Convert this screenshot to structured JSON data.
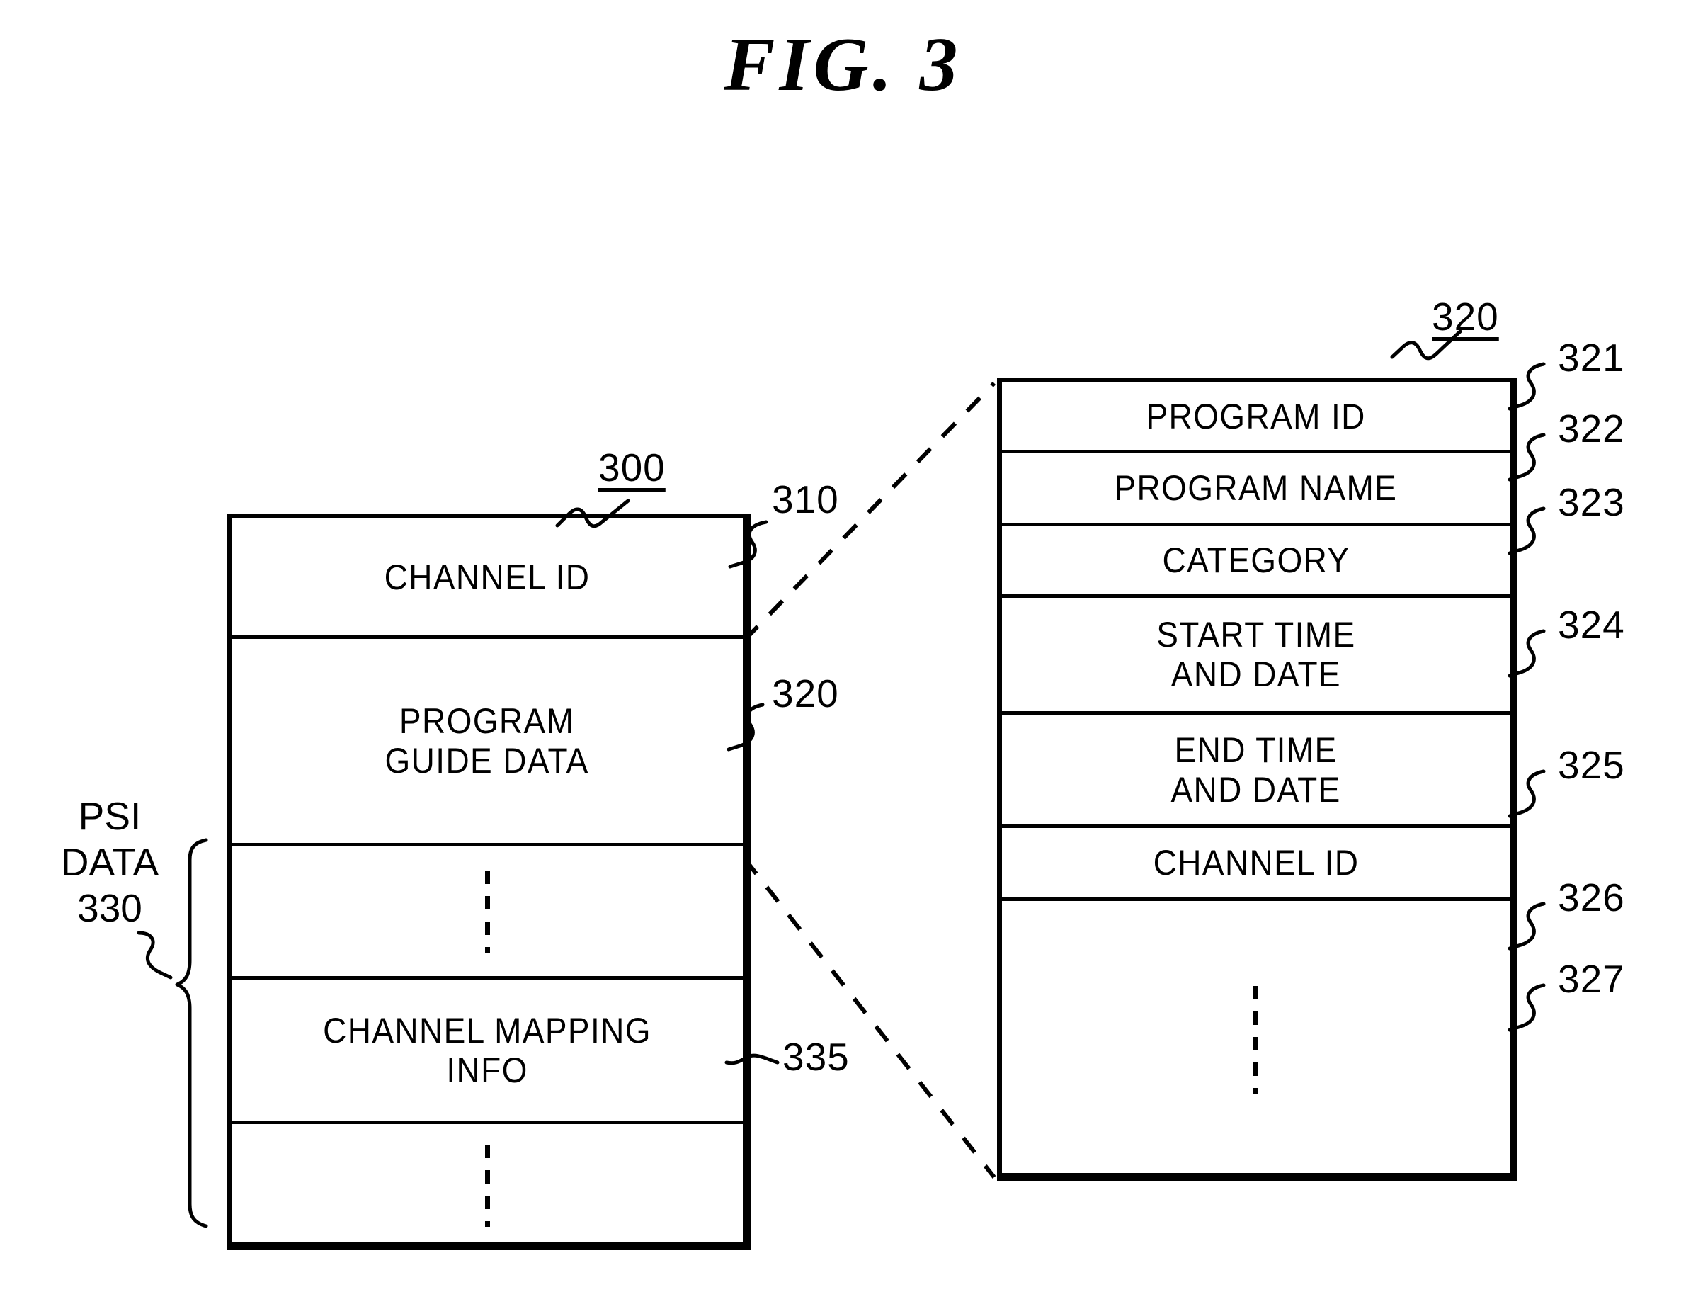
{
  "figure": {
    "title": "FIG.  3"
  },
  "left_structure": {
    "ref": "300",
    "rows": [
      {
        "label": "CHANNEL ID",
        "ref": "310",
        "kind": "text"
      },
      {
        "label": "PROGRAM\nGUIDE DATA",
        "ref": "320",
        "kind": "text"
      },
      {
        "label": "",
        "ref": "",
        "kind": "ellipsis"
      },
      {
        "label": "CHANNEL MAPPING\nINFO",
        "ref": "335",
        "kind": "text"
      },
      {
        "label": "",
        "ref": "",
        "kind": "ellipsis"
      }
    ],
    "group_label": "PSI\nDATA\n330"
  },
  "right_structure": {
    "ref": "320",
    "rows": [
      {
        "label": "PROGRAM ID",
        "ref": "321",
        "kind": "text"
      },
      {
        "label": "PROGRAM NAME",
        "ref": "322",
        "kind": "text"
      },
      {
        "label": "CATEGORY",
        "ref": "323",
        "kind": "text"
      },
      {
        "label": "START TIME\nAND DATE",
        "ref": "324",
        "kind": "text"
      },
      {
        "label": "END TIME\nAND DATE",
        "ref": "325",
        "kind": "text"
      },
      {
        "label": "CHANNEL ID",
        "ref": "326",
        "kind": "text"
      },
      {
        "label": "",
        "ref": "327",
        "kind": "ellipsis"
      }
    ]
  },
  "colors": {
    "ink": "#000000",
    "paper": "#ffffff"
  }
}
